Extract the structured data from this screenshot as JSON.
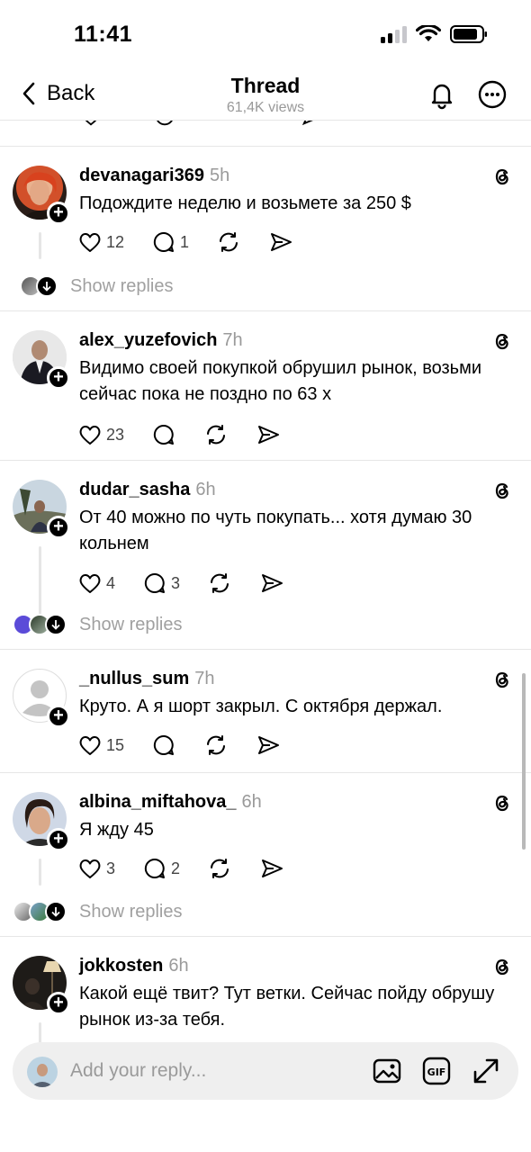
{
  "status": {
    "time": "11:41"
  },
  "header": {
    "back_label": "Back",
    "title": "Thread",
    "subtitle": "61,4K views"
  },
  "posts": [
    {
      "username": "devanagari369",
      "ago": "5h",
      "text": "Подождите неделю и возьмете за 250 $",
      "likes": "12",
      "comments": "1",
      "show_replies": "Show replies"
    },
    {
      "username": "alex_yuzefovich",
      "ago": "7h",
      "text": "Видимо своей покупкой обрушил рынок, возьми сейчас пока не поздно по 63 х",
      "likes": "23",
      "comments": ""
    },
    {
      "username": "dudar_sasha",
      "ago": "6h",
      "text": "От 40 можно по чуть покупать... хотя думаю 30 кольнем",
      "likes": "4",
      "comments": "3",
      "show_replies": "Show replies"
    },
    {
      "username": "_nullus_sum",
      "ago": "7h",
      "text": "Круто. А я шорт закрыл. С октября держал.",
      "likes": "15",
      "comments": ""
    },
    {
      "username": "albina_miftahova_",
      "ago": "6h",
      "text": "Я жду 45",
      "likes": "3",
      "comments": "2",
      "show_replies": "Show replies"
    },
    {
      "username": "jokkosten",
      "ago": "6h",
      "text": "Какой ещё твит? Тут ветки. Сейчас пойду обрушу рынок из-за тебя."
    }
  ],
  "reply_bar": {
    "placeholder": "Add your reply..."
  },
  "colors": {
    "muted": "#9a9a9a",
    "divider": "#e6e6e6",
    "bar_bg": "#efefef"
  }
}
